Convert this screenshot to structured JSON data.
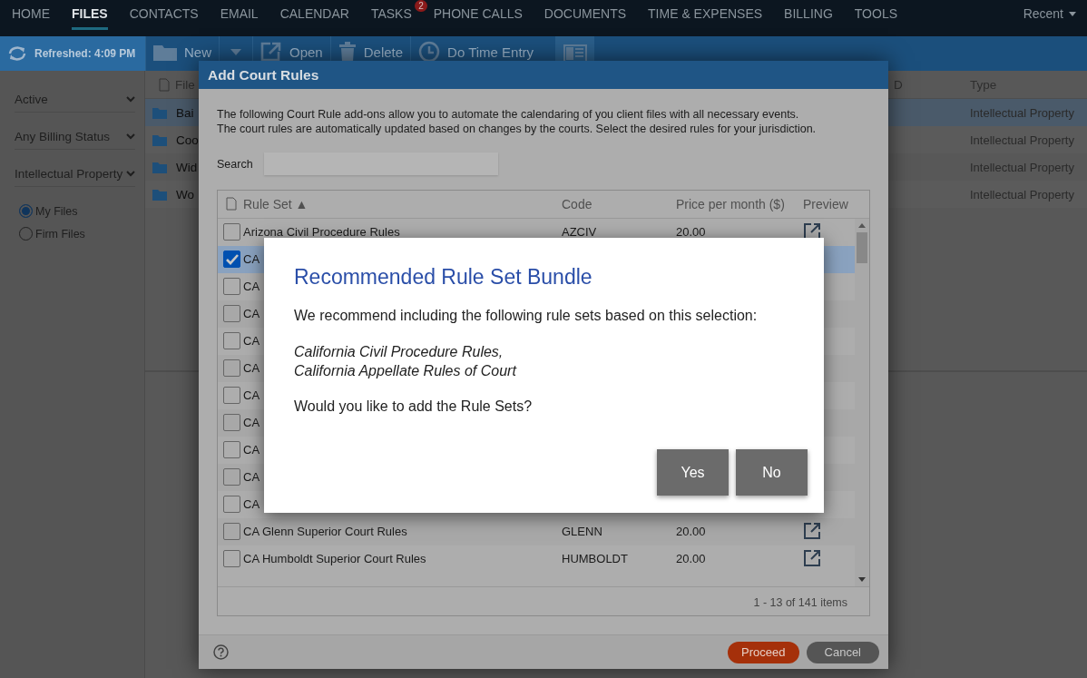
{
  "nav": {
    "items": [
      {
        "label": "HOME",
        "selected": false
      },
      {
        "label": "FILES",
        "selected": true
      },
      {
        "label": "CONTACTS",
        "selected": false
      },
      {
        "label": "EMAIL",
        "selected": false
      },
      {
        "label": "CALENDAR",
        "selected": false
      },
      {
        "label": "TASKS",
        "selected": false,
        "badge": "2"
      },
      {
        "label": "PHONE CALLS",
        "selected": false
      },
      {
        "label": "DOCUMENTS",
        "selected": false
      },
      {
        "label": "TIME & EXPENSES",
        "selected": false
      },
      {
        "label": "BILLING",
        "selected": false
      },
      {
        "label": "TOOLS",
        "selected": false
      }
    ],
    "recent": "Recent"
  },
  "toolbar": {
    "refreshed": "Refreshed: 4:09 PM",
    "buttons": [
      {
        "kind": "new",
        "label": "New"
      },
      {
        "kind": "caret"
      },
      {
        "kind": "open",
        "label": "Open"
      },
      {
        "kind": "delete",
        "label": "Delete"
      },
      {
        "kind": "time",
        "label": "Do Time Entry"
      },
      {
        "kind": "panel"
      }
    ]
  },
  "sidebar": {
    "filters": [
      "Active",
      "Any Billing Status",
      "Intellectual Property"
    ],
    "scope": [
      {
        "label": "My Files",
        "selected": true
      },
      {
        "label": "Firm Files",
        "selected": false
      }
    ]
  },
  "files": {
    "columns": [
      "File",
      "D",
      "Type"
    ],
    "rows": [
      {
        "name": "Bai",
        "type": "Intellectual Property",
        "selected": true
      },
      {
        "name": "Coo",
        "type": "Intellectual Property",
        "selected": false
      },
      {
        "name": "Wid",
        "type": "Intellectual Property",
        "selected": false
      },
      {
        "name": "Wo",
        "type": "Intellectual Property",
        "selected": false
      }
    ]
  },
  "dialog": {
    "title": "Add Court Rules",
    "intro": [
      "The following Court Rule add-ons allow you to automate the calendaring of you client files with all necessary events.",
      "The court rules are automatically updated based on changes by the courts. Select the desired rules for your jurisdiction."
    ],
    "search": {
      "label": "Search"
    },
    "table": {
      "columns": [
        "Rule Set ▲",
        "Code",
        "Price per month ($)",
        "Preview"
      ],
      "rows": [
        {
          "rule": "Arizona Civil Procedure Rules",
          "code": "AZCIV",
          "price": "20.00",
          "checked": false,
          "selected": false
        },
        {
          "rule": "CA",
          "checked": true,
          "selected": true
        },
        {
          "rule": "CA",
          "checked": false,
          "selected": false
        },
        {
          "rule": "CA",
          "checked": false,
          "selected": false
        },
        {
          "rule": "CA",
          "checked": false,
          "selected": false
        },
        {
          "rule": "CA",
          "checked": false,
          "selected": false
        },
        {
          "rule": "CA",
          "checked": false,
          "selected": false
        },
        {
          "rule": "CA",
          "checked": false,
          "selected": false
        },
        {
          "rule": "CA",
          "checked": false,
          "selected": false
        },
        {
          "rule": "CA",
          "checked": false,
          "selected": false
        },
        {
          "rule": "CA",
          "checked": false,
          "selected": false
        },
        {
          "rule": "CA Glenn Superior Court Rules",
          "code": "GLENN",
          "price": "20.00",
          "checked": false,
          "selected": false
        },
        {
          "rule": "CA Humboldt Superior Court Rules",
          "code": "HUMBOLDT",
          "price": "20.00",
          "checked": false,
          "selected": false
        }
      ],
      "pager": "1 - 13 of 141 items"
    },
    "buttons": [
      {
        "kind": "primary",
        "label": "Proceed"
      },
      {
        "kind": "secondary",
        "label": "Cancel"
      }
    ]
  },
  "modal": {
    "title": "Recommended Rule Set Bundle",
    "message": "We recommend including the following rule sets based on this selection:",
    "rule_sets": [
      "California Civil Procedure Rules,",
      "California Appellate Rules of Court"
    ],
    "question": "Would you like to add the Rule Sets?",
    "buttons": [
      "Yes",
      "No"
    ]
  }
}
